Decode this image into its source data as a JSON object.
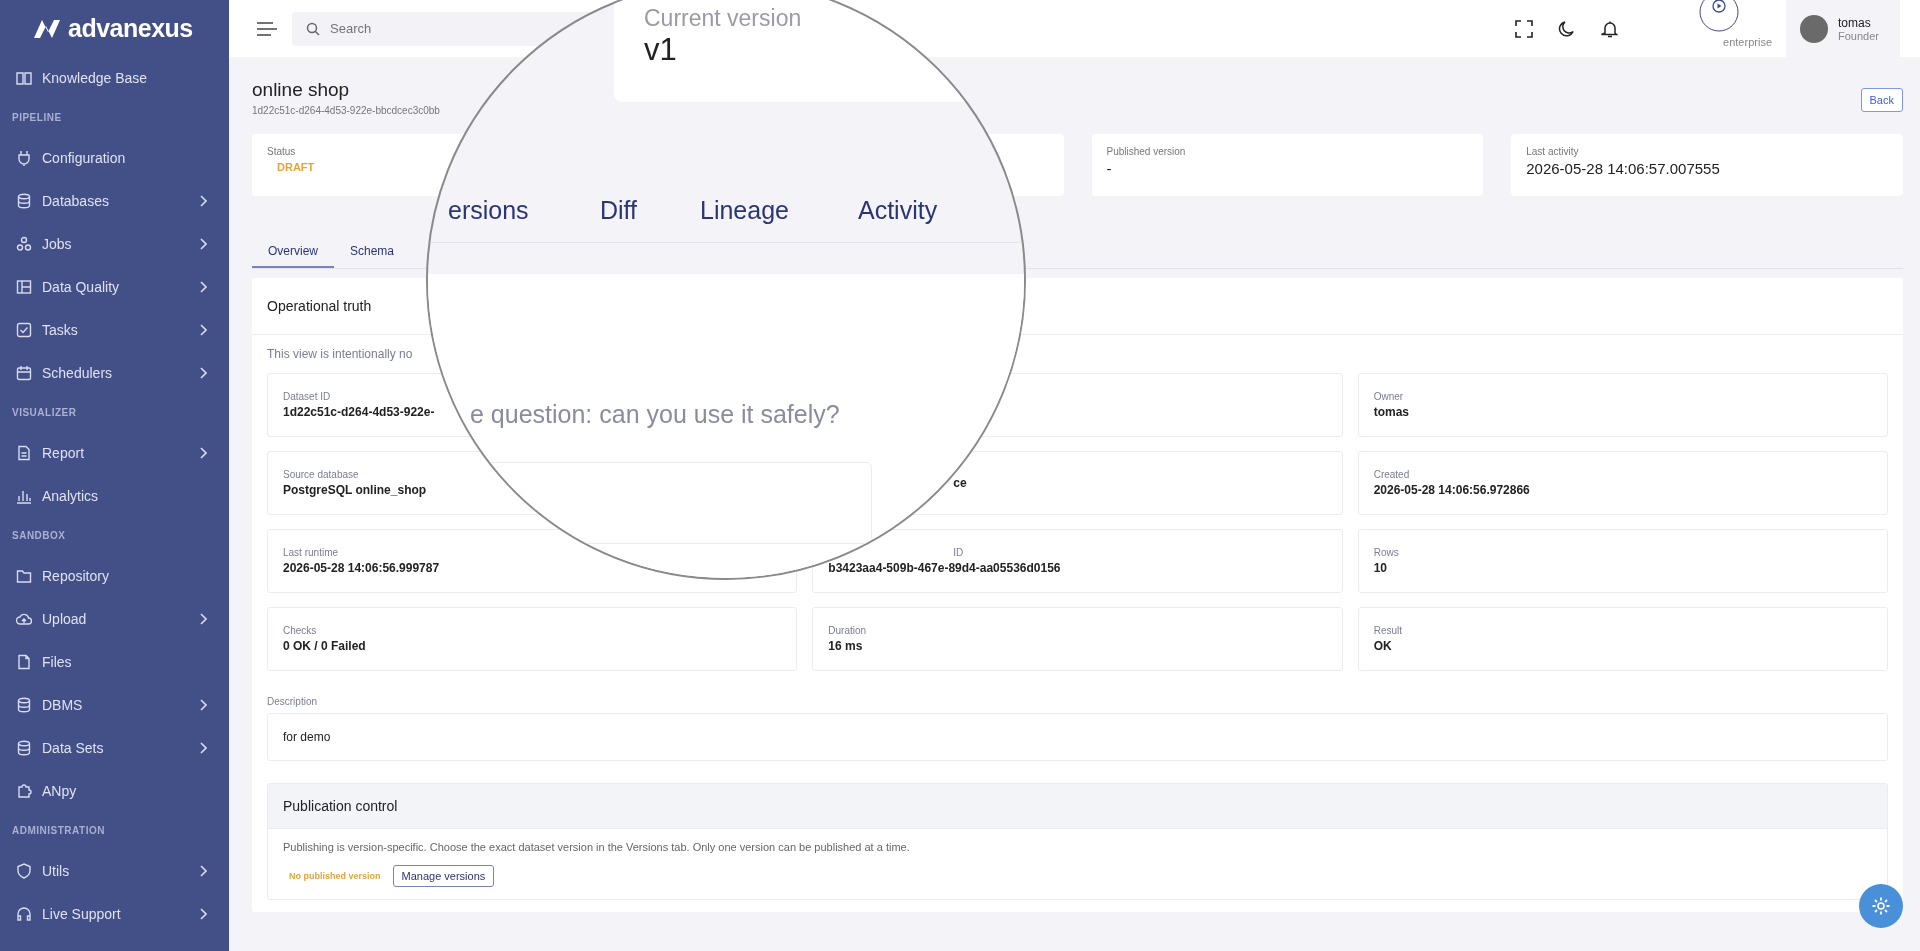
{
  "brand": {
    "name": "advanexus"
  },
  "sidebar": {
    "sections": [
      {
        "items": [
          {
            "label": "Knowledge Base",
            "expandable": false
          }
        ]
      },
      {
        "title": "PIPELINE",
        "items": [
          {
            "label": "Configuration",
            "expandable": false
          },
          {
            "label": "Databases",
            "expandable": true
          },
          {
            "label": "Jobs",
            "expandable": true
          },
          {
            "label": "Data Quality",
            "expandable": true
          },
          {
            "label": "Tasks",
            "expandable": true
          },
          {
            "label": "Schedulers",
            "expandable": true
          }
        ]
      },
      {
        "title": "VISUALIZER",
        "items": [
          {
            "label": "Report",
            "expandable": true
          },
          {
            "label": "Analytics",
            "expandable": false
          }
        ]
      },
      {
        "title": "SANDBOX",
        "items": [
          {
            "label": "Repository",
            "expandable": false
          },
          {
            "label": "Upload",
            "expandable": true
          },
          {
            "label": "Files",
            "expandable": false
          },
          {
            "label": "DBMS",
            "expandable": true
          },
          {
            "label": "Data Sets",
            "expandable": true
          },
          {
            "label": "ANpy",
            "expandable": false
          }
        ]
      },
      {
        "title": "ADMINISTRATION",
        "items": [
          {
            "label": "Utils",
            "expandable": true
          },
          {
            "label": "Live Support",
            "expandable": true
          }
        ]
      }
    ]
  },
  "header": {
    "search": {
      "placeholder": "Search"
    },
    "plan": "enterprise",
    "user": {
      "name": "tomas",
      "role": "Founder"
    }
  },
  "page": {
    "title": "online shop",
    "subtitle": "1d22c51c-d264-4d53-922e-bbcdcec3c0bb",
    "back": "Back"
  },
  "stats": [
    {
      "label": "Status",
      "value": "DRAFT",
      "kind": "status"
    },
    {
      "kind": "hidden"
    },
    {
      "label": "Published version",
      "value": "-",
      "kind": "text"
    },
    {
      "label": "Last activity",
      "value": "2026-05-28 14:06:57.007555",
      "kind": "text"
    }
  ],
  "tabs": [
    {
      "label": "Overview",
      "selected": true
    },
    {
      "label": "Schema",
      "selected": false
    }
  ],
  "overview": {
    "title": "Operational truth",
    "note": "This view is intentionally no",
    "rows": [
      {
        "fields": [
          {
            "label": "Dataset ID",
            "value": "1d22c51c-d264-4d53-922e-",
            "covered": false
          },
          {
            "label": "Owner",
            "value": "tomas",
            "covered": false
          }
        ]
      },
      {
        "fields": [
          {
            "label": "Source database",
            "value": "PostgreSQL online_shop",
            "covered": false
          },
          {
            "value": "ce",
            "covered": true
          },
          {
            "label": "Created",
            "value": "2026-05-28 14:06:56.972866",
            "covered": false
          }
        ]
      },
      {
        "fields": [
          {
            "label": "Last runtime",
            "value": "2026-05-28 14:06:56.999787",
            "covered": false
          },
          {
            "label": "ID",
            "value": "b3423aa4-509b-467e-89d4-aa05536d0156",
            "covered": true
          },
          {
            "label": "Rows",
            "value": "10",
            "covered": false
          }
        ]
      },
      {
        "fields": [
          {
            "label": "Checks",
            "value": "0 OK / 0 Failed",
            "covered": false
          },
          {
            "label": "Duration",
            "value": "16 ms",
            "covered": false
          },
          {
            "label": "Result",
            "value": "OK",
            "covered": false
          }
        ]
      }
    ],
    "description": {
      "label": "Description",
      "value": "for demo"
    },
    "publication": {
      "title": "Publication control",
      "text": "Publishing is version-specific. Choose the exact dataset version in the Versions tab. Only one version can be published at a time.",
      "state": "No published version",
      "button": "Manage versions"
    }
  },
  "magnifier": {
    "card_label": "Current version",
    "card_value": "v1",
    "tabs": [
      {
        "label": "ersions"
      },
      {
        "label": "Diff"
      },
      {
        "label": "Lineage"
      },
      {
        "label": "Activity"
      }
    ],
    "text": "e question: can you use it safely?"
  }
}
